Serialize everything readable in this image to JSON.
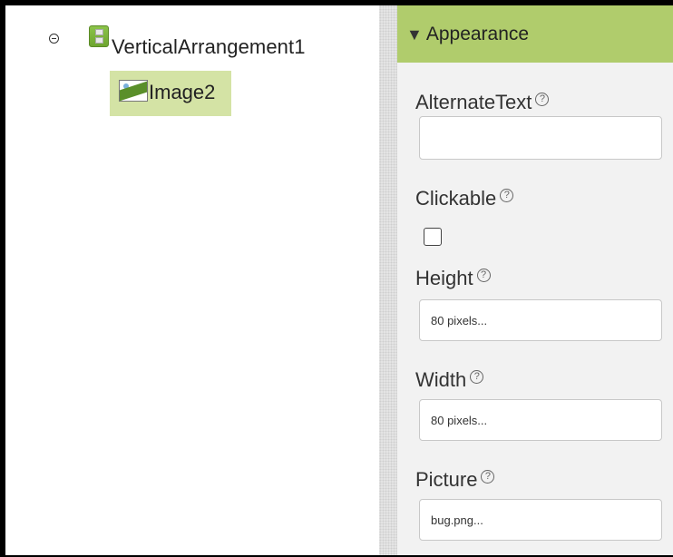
{
  "tree": {
    "root": {
      "label": "VerticalArrangement1",
      "icon": "vertical-arrangement-icon"
    },
    "child": {
      "label": "Image2",
      "icon": "image-icon",
      "selected": true
    },
    "collapse_icon": "collapse-icon"
  },
  "properties": {
    "section": {
      "title": "Appearance",
      "icon": "triangle-down-icon"
    },
    "help_glyph": "?",
    "alternate_text": {
      "label": "AlternateText",
      "value": ""
    },
    "clickable": {
      "label": "Clickable",
      "checked": false
    },
    "height": {
      "label": "Height",
      "value": "80 pixels..."
    },
    "width": {
      "label": "Width",
      "value": "80 pixels..."
    },
    "picture": {
      "label": "Picture",
      "value": "bug.png..."
    }
  },
  "colors": {
    "section_header": "#b0cc6c",
    "selected_row": "#d4e3a5",
    "panel_bg": "#f2f2f2"
  }
}
